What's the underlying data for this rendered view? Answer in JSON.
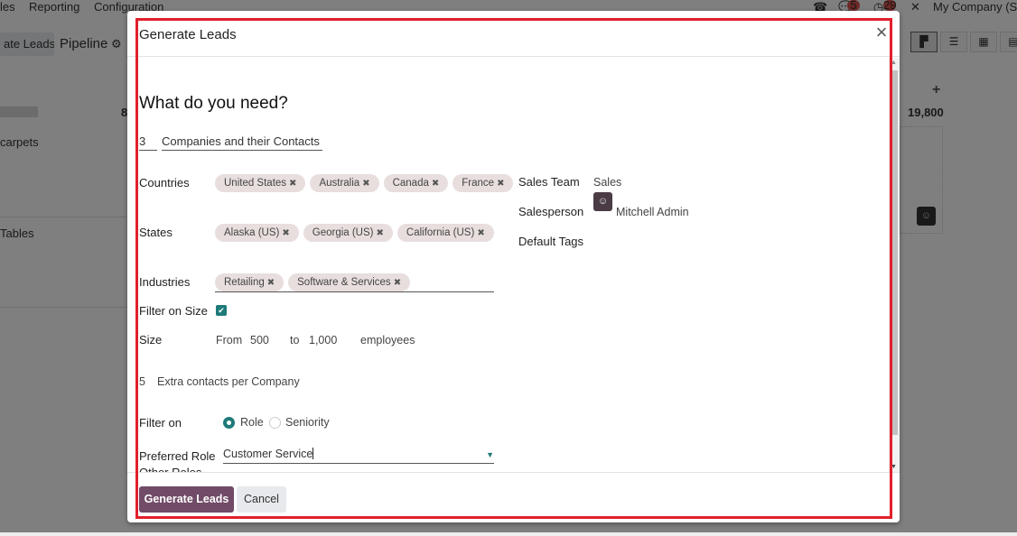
{
  "background": {
    "top_menu": [
      "les",
      "Reporting",
      "Configuration"
    ],
    "new_button_label": "ate Leads",
    "page_title": "Pipeline",
    "company": "My Company (Sa",
    "badges": {
      "messages": "5",
      "activities": "29"
    },
    "columns": {
      "left_count": "8",
      "right_total": "19,800"
    },
    "cards": [
      "carpets",
      "Tables"
    ],
    "view_modes": [
      "kanban",
      "list",
      "calendar",
      "pivot"
    ]
  },
  "modal": {
    "title": "Generate Leads",
    "heading": "What do you need?",
    "count": "3",
    "search_type": "Companies and their Contacts",
    "countries": {
      "label": "Countries",
      "tags": [
        "United States",
        "Australia",
        "Canada",
        "France"
      ]
    },
    "states": {
      "label": "States",
      "tags": [
        "Alaska (US)",
        "Georgia (US)",
        "California (US)"
      ]
    },
    "industries": {
      "label": "Industries",
      "tags": [
        "Retailing",
        "Software & Services"
      ]
    },
    "filter_on_size": {
      "label": "Filter on Size",
      "checked": true
    },
    "size": {
      "label": "Size",
      "from_label": "From",
      "from": "500",
      "to_label": "to",
      "to": "1,000",
      "unit": "employees"
    },
    "extra_contacts": {
      "count": "5",
      "label": "Extra contacts per Company"
    },
    "filter_on": {
      "label": "Filter on",
      "options": [
        "Role",
        "Seniority"
      ],
      "selected": "Role"
    },
    "preferred_role": {
      "label": "Preferred Role",
      "value": "Customer Service"
    },
    "other_roles_label": "Other Roles",
    "sales_team": {
      "label": "Sales Team",
      "value": "Sales"
    },
    "salesperson": {
      "label": "Salesperson",
      "value": "Mitchell Admin"
    },
    "default_tags": {
      "label": "Default Tags",
      "value": ""
    },
    "buttons": {
      "primary": "Generate Leads",
      "secondary": "Cancel"
    }
  }
}
